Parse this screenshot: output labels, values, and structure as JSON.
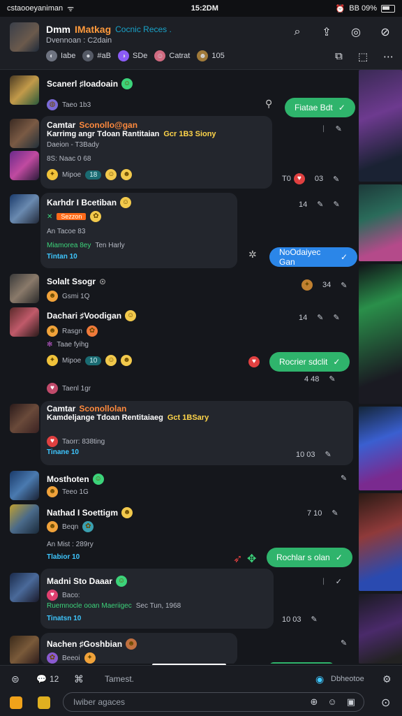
{
  "status": {
    "carrier": "cstaooeyaniman",
    "time": "15:2DM",
    "battery": "BB 09%"
  },
  "header": {
    "title": "Dmm",
    "title_accent": "IMatkag",
    "tag": "Cocnic Reces .",
    "subtitle": "Dvennoan : C2dain",
    "chips": [
      {
        "label": "Iabe",
        "color": "#6e7380"
      },
      {
        "label": "#aB",
        "color": "#555a66"
      },
      {
        "label": "SDe",
        "color": "#8b5cf6"
      },
      {
        "label": "Catrat",
        "color": "#d06a80"
      },
      {
        "label": "105",
        "color": "#a07a3a"
      }
    ]
  },
  "messages": {
    "m1": {
      "name": "Scanerl ♯Ioadoain",
      "sub": "Taeo 1b3",
      "bubble": "Fiatae Bdt"
    },
    "m2": {
      "name": "Camtar",
      "name_tag": "Sconollo@gan",
      "line2": "Karrimg angr Tdoan Rantitaian",
      "line2_tag": "Gcr 1B3 Siony",
      "line3": "Daeion - T3Bady",
      "line4": "8S: Naac 0 68",
      "line5": "Mipoe",
      "count": "18",
      "meta_num": "T0",
      "meta_time": "03"
    },
    "m3": {
      "name": "Karhdr I Bcetiban",
      "badge": "Sezzon",
      "line2": "An Tacoe 83",
      "line3": "Miamorea 8ey",
      "line3b": "Ten Harly",
      "line4": "Tintan 10",
      "time": "14",
      "bubble": "NoOdaiyec Gan"
    },
    "m4": {
      "name": "Solalt Ssogr",
      "sub": "Gsmi 1Q",
      "time": "34"
    },
    "m5": {
      "name": "Dachari ♯Voodigan",
      "sub": "Rasgn",
      "line3": "Taae fyihg",
      "line4": "Mipoe",
      "count": "10",
      "time": "14",
      "bubble": "Rocrier sdclit",
      "below_time": "4  48",
      "below": "Taenl 1gr"
    },
    "m6": {
      "name": "Camtar",
      "name_tag": "Sconollolan",
      "line2": "Kamdeljange Tdoan Rentitaiaeg",
      "line2_tag": "Gct 1BSary",
      "line3": "Taorr: 838ting",
      "line4": "Tinane 10",
      "meta": "10  03"
    },
    "m7": {
      "name": "Mosthoten",
      "sub": "Teeo 1G"
    },
    "m8": {
      "name": "Nathad I Soettigm",
      "sub": "Beqn",
      "line3": "An Mist : 289ry",
      "line4": "Tlabior 10",
      "time": "7  10",
      "bubble": "Rochlar s olan"
    },
    "m9": {
      "name": "Madni Sto Daaar",
      "sub": "Baco:",
      "line3": "Ruemnocle ooan Maeriigec",
      "line3b": "Sec Tun, 1968",
      "line4": "Tinatsn 10",
      "meta": "10  03"
    },
    "m10": {
      "name": "Nachen ♯Goshbian",
      "sub": "Beeoi"
    }
  },
  "bottom": {
    "count": "12",
    "label": "Tamest.",
    "right_label": "Dbheotoe",
    "input_placeholder": "Iwiber agaces"
  }
}
